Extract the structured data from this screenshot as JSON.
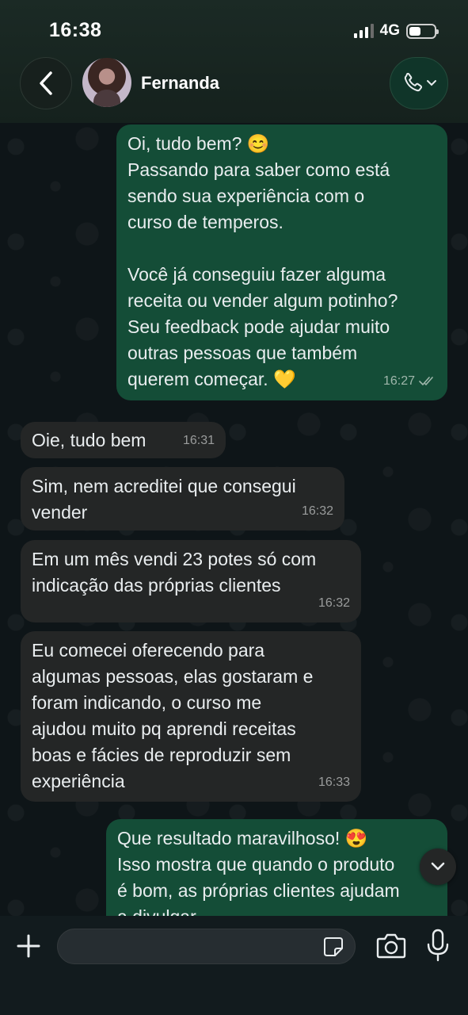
{
  "status_bar": {
    "time": "16:38",
    "network": "4G"
  },
  "header": {
    "contact_name": "Fernanda"
  },
  "messages": [
    {
      "dir": "out",
      "text": "Oi, tudo bem? 😊\nPassando para saber como está\nsendo sua experiência com o\ncurso de temperos.\n\nVocê já conseguiu fazer alguma\nreceita ou vender algum potinho?\nSeu feedback pode ajudar muito\noutras pessoas que também\nquerem começar. 💛",
      "time": "16:27",
      "status": "read"
    },
    {
      "dir": "in",
      "text": "Oie, tudo bem",
      "time": "16:31"
    },
    {
      "dir": "in",
      "text": "Sim, nem acreditei que consegui\nvender",
      "time": "16:32"
    },
    {
      "dir": "in",
      "text": "Em um mês vendi 23 potes só com\nindicação das próprias clientes",
      "time": "16:32"
    },
    {
      "dir": "in",
      "text": "Eu comecei oferecendo para\nalgumas pessoas, elas gostaram e\nforam indicando, o curso me\najudou muito pq aprendi receitas\nboas e fácies de reproduzir sem\nexperiência",
      "time": "16:33"
    },
    {
      "dir": "out",
      "text": "Que resultado maravilhoso! 😍\nIsso mostra que quando o produto\né bom, as próprias clientes ajudam\na divulgar",
      "time": ""
    }
  ],
  "composer": {
    "placeholder": ""
  },
  "icons": {
    "back": "chevron-left-icon",
    "call": "phone-icon",
    "scroll": "chevron-down-icon",
    "plus": "plus-icon",
    "sticker": "sticker-icon",
    "camera": "camera-icon",
    "mic": "microphone-icon"
  },
  "colors": {
    "outgoing_bubble": "#144d37",
    "incoming_bubble": "#242626",
    "read_ticks": "#9fb6ab"
  }
}
